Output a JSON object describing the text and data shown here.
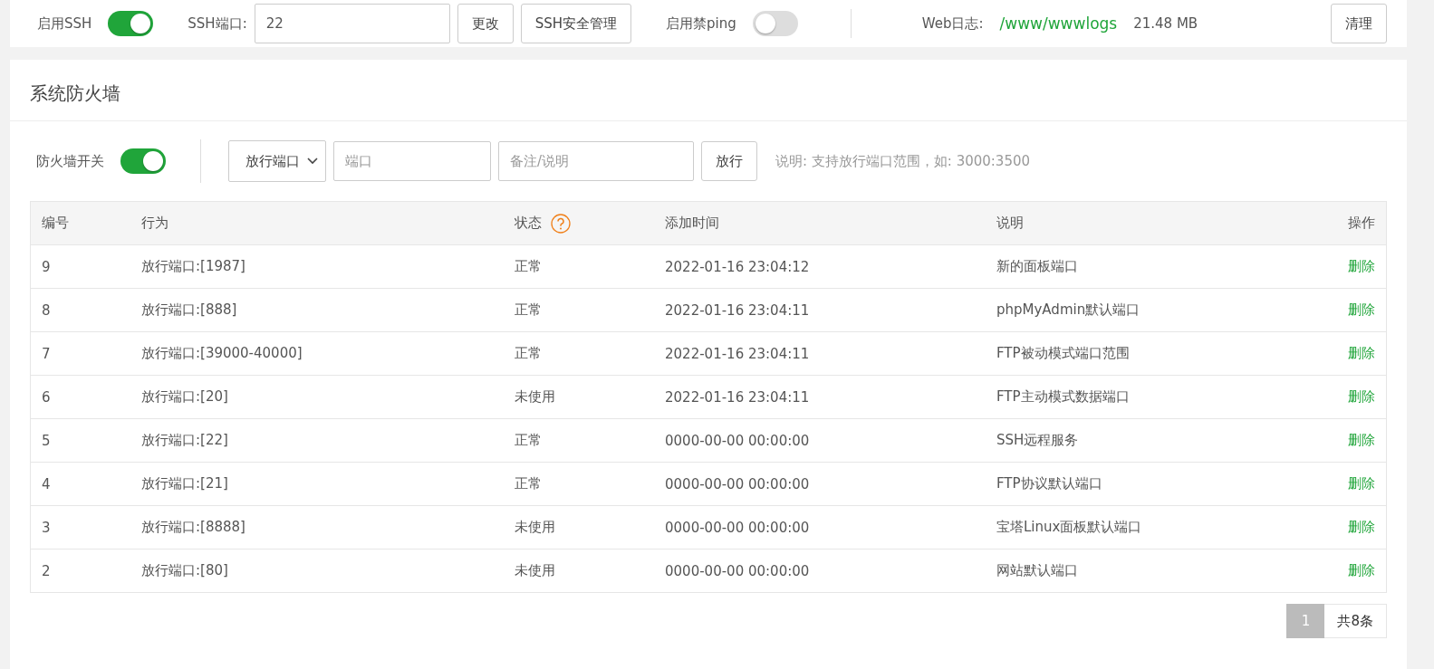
{
  "top_settings": {
    "ssh_toggle": {
      "label": "启用SSH",
      "on": true
    },
    "ssh_port": {
      "label": "SSH端口:",
      "value": "22"
    },
    "buttons": [
      "更改",
      "SSH安全管理"
    ],
    "ping_toggle": {
      "label": "启用禁ping",
      "on": false
    },
    "web_log": {
      "label": "Web日志:",
      "path": "/www/wwwlogs",
      "size": "21.48 MB",
      "button": "清理"
    }
  },
  "firewall": {
    "title": "系统防火墙",
    "switch": {
      "label": "防火墙开关",
      "on": true
    },
    "type_select": {
      "value": "放行端口"
    },
    "port_field": {
      "placeholder": "端口"
    },
    "note_field": {
      "placeholder": "备注/说明"
    },
    "add_button": "放行",
    "hint": "说明: 支持放行端口范围，如: 3000:3500",
    "table": {
      "columns": [
        "编号",
        "行为",
        "状态",
        "添加时间",
        "说明",
        "操作"
      ],
      "rows": [
        {
          "id": "9",
          "action": "放行端口:[1987]",
          "status": "正常",
          "time": "2022-01-16 23:04:12",
          "note": "新的面板端口",
          "op": "删除"
        },
        {
          "id": "8",
          "action": "放行端口:[888]",
          "status": "正常",
          "time": "2022-01-16 23:04:11",
          "note": "phpMyAdmin默认端口",
          "op": "删除"
        },
        {
          "id": "7",
          "action": "放行端口:[39000-40000]",
          "status": "正常",
          "time": "2022-01-16 23:04:11",
          "note": "FTP被动模式端口范围",
          "op": "删除"
        },
        {
          "id": "6",
          "action": "放行端口:[20]",
          "status": "未使用",
          "time": "2022-01-16 23:04:11",
          "note": "FTP主动模式数据端口",
          "op": "删除"
        },
        {
          "id": "5",
          "action": "放行端口:[22]",
          "status": "正常",
          "time": "0000-00-00 00:00:00",
          "note": "SSH远程服务",
          "op": "删除"
        },
        {
          "id": "4",
          "action": "放行端口:[21]",
          "status": "正常",
          "time": "0000-00-00 00:00:00",
          "note": "FTP协议默认端口",
          "op": "删除"
        },
        {
          "id": "3",
          "action": "放行端口:[8888]",
          "status": "未使用",
          "time": "0000-00-00 00:00:00",
          "note": "宝塔Linux面板默认端口",
          "op": "删除"
        },
        {
          "id": "2",
          "action": "放行端口:[80]",
          "status": "未使用",
          "time": "0000-00-00 00:00:00",
          "note": "网站默认端口",
          "op": "删除"
        }
      ]
    },
    "pagination": {
      "pages": [
        {
          "label": "1",
          "selected": true
        }
      ],
      "total": "共8条"
    }
  }
}
